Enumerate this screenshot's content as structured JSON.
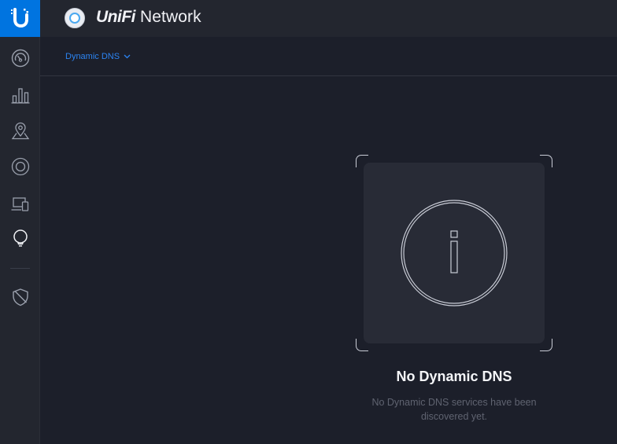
{
  "header": {
    "brand": "UniFi",
    "title": "Network"
  },
  "sidebar": {
    "items": [
      {
        "name": "dashboard",
        "icon": "dashboard-gauge-icon"
      },
      {
        "name": "statistics",
        "icon": "bar-chart-icon"
      },
      {
        "name": "map",
        "icon": "map-pin-icon"
      },
      {
        "name": "devices",
        "icon": "device-ring-icon"
      },
      {
        "name": "clients",
        "icon": "clients-devices-icon"
      },
      {
        "name": "insights",
        "icon": "lightbulb-icon"
      },
      {
        "name": "threat-management",
        "icon": "shield-icon"
      }
    ]
  },
  "subnav": {
    "selector_label": "Dynamic DNS"
  },
  "empty_state": {
    "title": "No Dynamic DNS",
    "description": "No Dynamic DNS services have been discovered yet."
  },
  "colors": {
    "accent": "#0074e0",
    "link": "#2c84f2",
    "background": "#1c1f2a",
    "panel": "#23262f"
  }
}
